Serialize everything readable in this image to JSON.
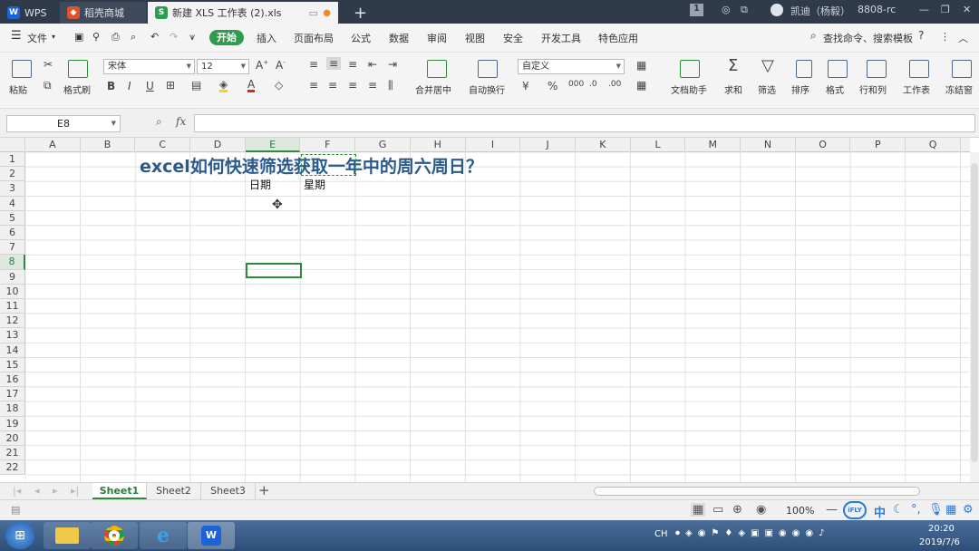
{
  "titlebar": {
    "wps_tab": "WPS",
    "store_tab": "稻壳商城",
    "doc_tab": "新建 XLS 工作表 (2).xls",
    "add_tab": "+",
    "user_name": "凯迪（杨毅）",
    "badge": "8808-rc"
  },
  "menu": {
    "file": "文件",
    "items": [
      "开始",
      "插入",
      "页面布局",
      "公式",
      "数据",
      "审阅",
      "视图",
      "安全",
      "开发工具",
      "特色应用"
    ],
    "search": "查找命令、搜索模板"
  },
  "ribbon": {
    "paste": "粘贴",
    "format_painter": "格式刷",
    "font_name": "宋体",
    "font_size": "12",
    "number_format": "自定义",
    "merge_center": "合并居中",
    "wrap": "自动换行",
    "doc_helper": "文档助手",
    "sum": "求和",
    "filter": "筛选",
    "sort": "排序",
    "format": "格式",
    "row_col": "行和列",
    "sheet": "工作表",
    "freeze": "冻结窗"
  },
  "formula_bar": {
    "name_box": "E8",
    "fx": "fx"
  },
  "columns": [
    "A",
    "B",
    "C",
    "D",
    "E",
    "F",
    "G",
    "H",
    "I",
    "J",
    "K",
    "L",
    "M",
    "N",
    "O",
    "P",
    "Q"
  ],
  "rows": [
    "1",
    "2",
    "3",
    "4",
    "5",
    "6",
    "7",
    "8",
    "9",
    "10",
    "11",
    "12",
    "13",
    "14",
    "15",
    "16",
    "17",
    "18",
    "19",
    "20",
    "21",
    "22"
  ],
  "cells": {
    "title_en": "excel",
    "title_zh": "如何快速筛选获取一年中的周六周日？",
    "e2": "日期",
    "f2": "星期"
  },
  "sheets": [
    "Sheet1",
    "Sheet2",
    "Sheet3"
  ],
  "sheet_add": "+",
  "status": {
    "zoom": "100%"
  },
  "taskbar": {
    "ime": "中",
    "time": "20:20",
    "date": "2019/7/6",
    "ch": "CH"
  }
}
